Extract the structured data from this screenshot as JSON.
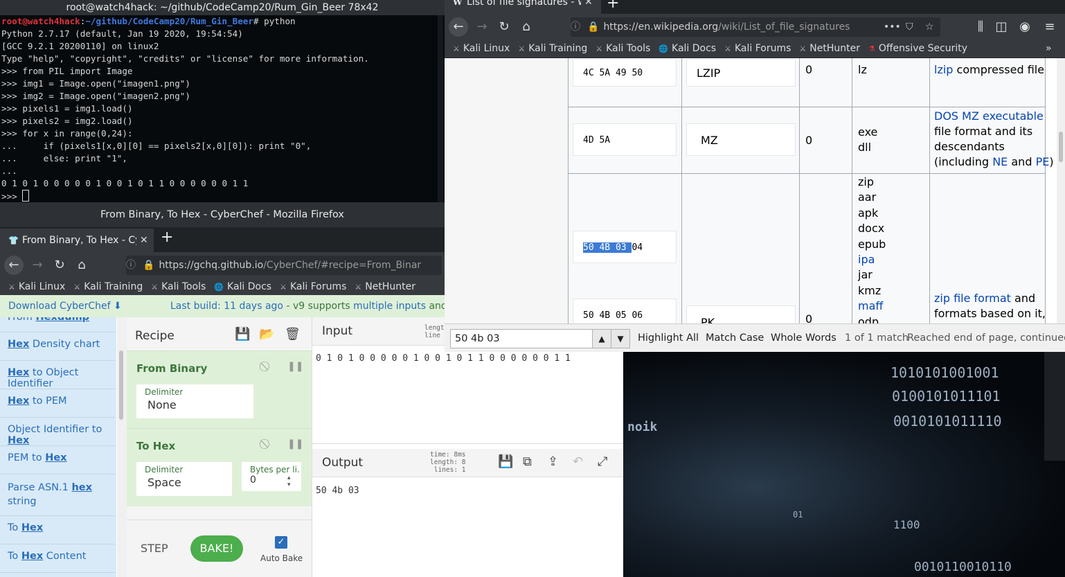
{
  "terminal": {
    "title": "root@watch4hack: ~/github/CodeCamp20/Rum_Gin_Beer 78x42",
    "prompt_user": "root@watch4hack",
    "prompt_path": "~/github/CodeCamp20/Rum_Gin_Beer",
    "prompt_cmd": "# python",
    "lines": [
      "Python 2.7.17 (default, Jan 19 2020, 19:54:54)",
      "[GCC 9.2.1 20200110] on linux2",
      "Type \"help\", \"copyright\", \"credits\" or \"license\" for more information.",
      ">>> from PIL import Image",
      ">>> img1 = Image.open(\"imagen1.png\")",
      ">>> img2 = Image.open(\"imagen2.png\")",
      ">>> pixels1 = img1.load()",
      ">>> pixels2 = img2.load()",
      ">>> for x in range(0,24):",
      "...     if (pixels1[x,0][0] == pixels2[x,0][0]): print \"0\",",
      "...     else: print \"1\",",
      "...",
      "0 1 0 1 0 0 0 0 0 1 0 0 1 0 1 1 0 0 0 0 0 0 1 1"
    ],
    "last_prompt": ">>> "
  },
  "cyberchef_window": {
    "title": "From Binary, To Hex - CyberChef - Mozilla Firefox",
    "tab_label": "From Binary, To Hex - CyberChef",
    "new_tab": "+",
    "url_domain": "https://gchq.github.io",
    "url_path": "/CyberChef/#recipe=From_Binar",
    "bookmarks": [
      "Kali Linux",
      "Kali Training",
      "Kali Tools",
      "Kali Docs",
      "Kali Forums",
      "NetHunter"
    ],
    "banner": {
      "download": "Download CyberChef",
      "download_icon": "⬇",
      "last_build": "Last build: 11 days ago",
      "v9": " - v9 supports ",
      "multi": "multiple inputs",
      "and": " and a Nod"
    },
    "operations": [
      {
        "pre": "From ",
        "hex": "Hexdump",
        "post": ""
      },
      {
        "pre": "",
        "hex": "Hex",
        "post": " Density chart"
      },
      {
        "pre": "",
        "hex": "Hex",
        "post": " to Object Identifier"
      },
      {
        "pre": "",
        "hex": "Hex",
        "post": " to PEM"
      },
      {
        "pre": "Object Identifier to ",
        "hex": "Hex",
        "post": ""
      },
      {
        "pre": "PEM to ",
        "hex": "Hex",
        "post": ""
      },
      {
        "pre": "Parse ASN.1 ",
        "hex": "hex",
        "post": "string"
      },
      {
        "pre": "To ",
        "hex": "Hex",
        "post": ""
      },
      {
        "pre": "To ",
        "hex": "Hex",
        "post": " Content"
      }
    ],
    "recipe": {
      "title": "Recipe",
      "ops": [
        {
          "name": "From Binary",
          "field_label": "Delimiter",
          "field_value": "None"
        },
        {
          "name": "To Hex",
          "field_label": "Delimiter",
          "field_value": "Space",
          "field2_label": "Bytes per li...",
          "field2_value": "0"
        }
      ],
      "step": "STEP",
      "bake": "BAKE!",
      "auto_bake": "Auto Bake"
    },
    "input": {
      "title": "Input",
      "stats_length": "length",
      "stats_lines": "line",
      "text": "0 1 0 1 0 0 0 0 0 1 0 0 1 0 1 1 0 0 0 0 0 0 1 1"
    },
    "output": {
      "title": "Output",
      "time_label": "time:",
      "time": "8ms",
      "length_label": "length:",
      "length": "8",
      "lines_label": "lines:",
      "lines": "1",
      "text": "50 4b 03"
    }
  },
  "wikipedia_window": {
    "tab_label": "List of file signatures - W",
    "url_domain": "https://en.wikipedia.org",
    "url_path": "/wiki/List_of_file_signatures",
    "more": "•••",
    "bookmarks": [
      "Kali Linux",
      "Kali Training",
      "Kali Tools",
      "Kali Docs",
      "Kali Forums",
      "NetHunter",
      "Offensive Security"
    ],
    "rows": [
      {
        "hex": "4C 5A 49 50",
        "iso": "LZIP",
        "offset": "0",
        "ext": [
          "lz"
        ],
        "desc_link": "lzip",
        "desc_rest": " compressed file"
      },
      {
        "hex": "4D 5A",
        "iso": "MZ",
        "offset": "0",
        "ext": [
          "exe",
          "dll"
        ],
        "desc_link": "DOS MZ executable",
        "desc_lines": [
          "file format and its",
          "descendants"
        ],
        "desc_inc": "(including ",
        "ne": "NE",
        "and": " and ",
        "pe": "PE",
        "close": ")"
      },
      {
        "hex_hl": "50 4B 03 ",
        "hex_rest": "04",
        "hex2": "50 4B 05 06",
        "iso": "PK",
        "offset": "0",
        "ext": [
          "zip",
          "aar",
          "apk",
          "docx",
          "epub",
          "ipa",
          "jar",
          "kmz",
          "maff",
          "odp"
        ],
        "desc_link": "zip file format",
        "desc_rest": " and",
        "desc_line2": "formats based on it,"
      }
    ],
    "find": {
      "query": "50 4b 03",
      "highlight_all": "Highlight All",
      "match_case": "Match Case",
      "whole_words": "Whole Words",
      "count": "1 of 1 match",
      "status": "Reached end of page, continued from"
    }
  },
  "wallpaper_binary": [
    "1010101001001",
    "0100101011101",
    "0010101011110",
    "1100",
    "0010110010110",
    "noik",
    "01"
  ]
}
